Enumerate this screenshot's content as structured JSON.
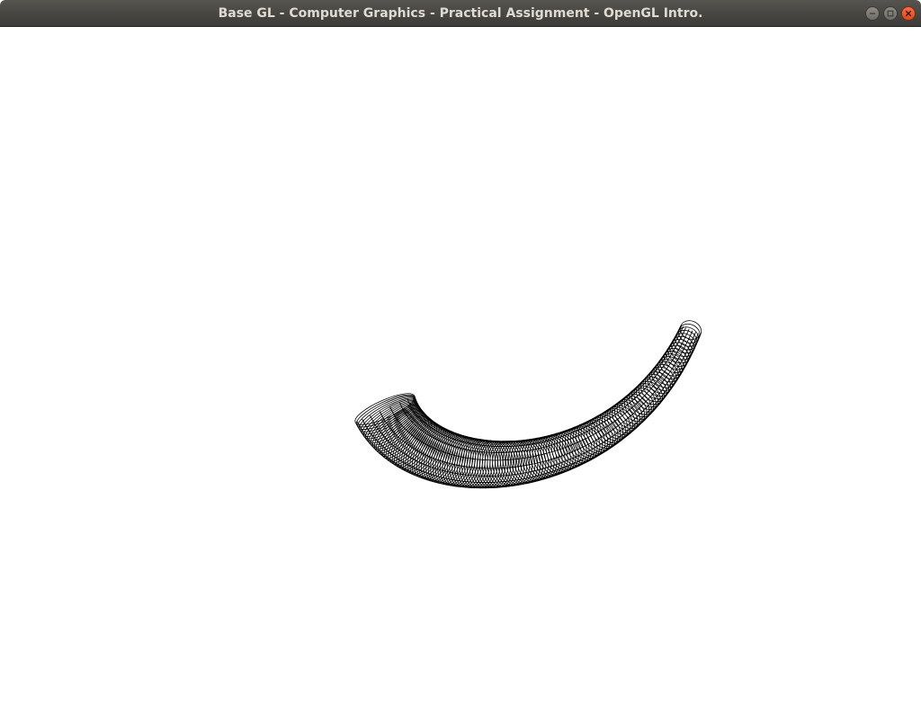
{
  "window": {
    "title": "Base GL - Computer Graphics - Practical Assignment - OpenGL Intro.",
    "titlebar_color": "#3c3b37",
    "title_color": "#dfdbd2",
    "close_color": "#e95420"
  },
  "controls": {
    "minimize_icon": "minimize-icon",
    "maximize_icon": "maximize-icon",
    "close_icon": "close-icon"
  },
  "canvas": {
    "background": "#ffffff",
    "object": {
      "description_icon": "wireframe-curved-tube",
      "stroke_color": "#000000"
    }
  }
}
